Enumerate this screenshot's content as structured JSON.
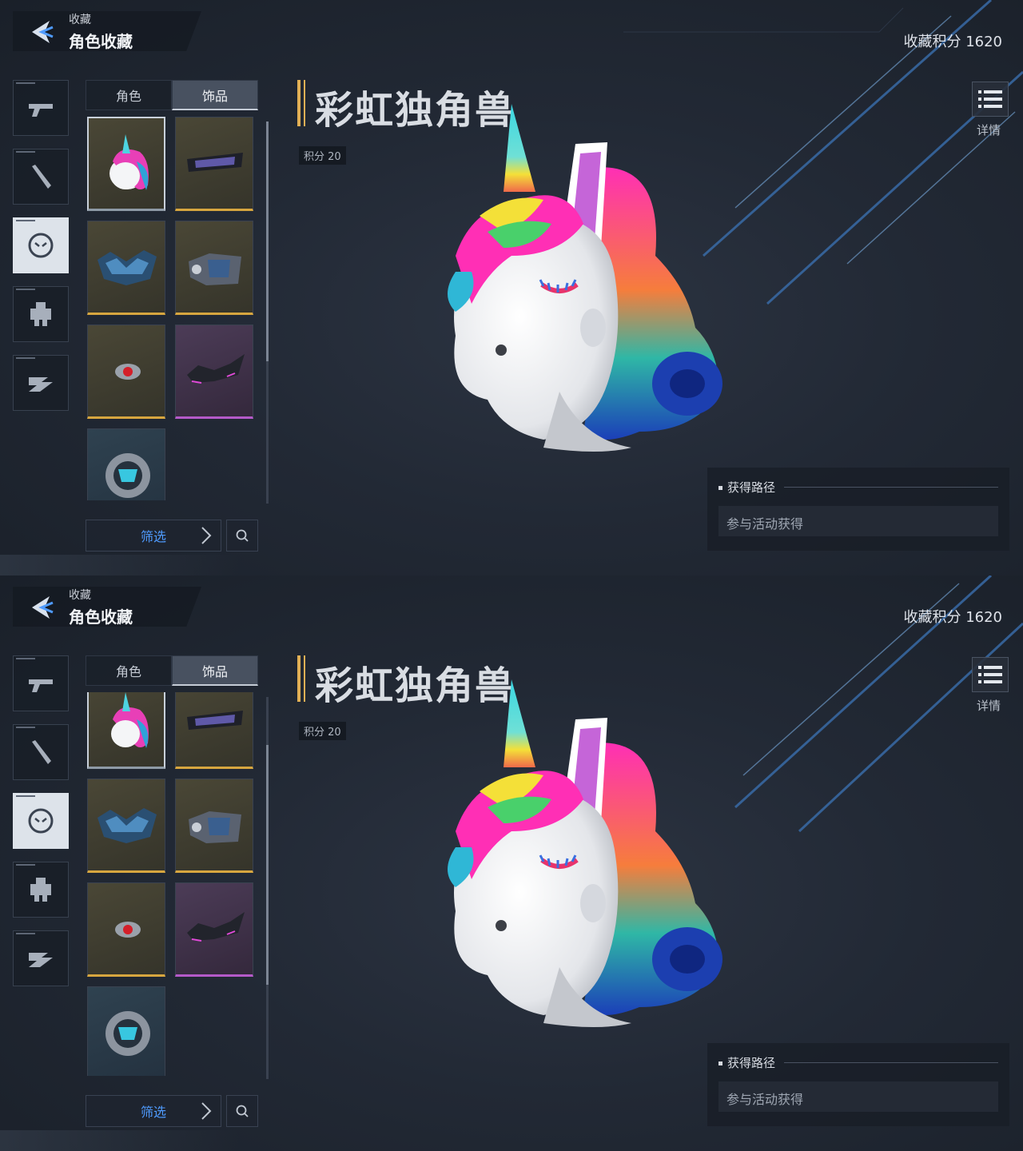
{
  "header": {
    "breadcrumb": "收藏",
    "title": "角色收藏",
    "score_total": "收藏积分 1620"
  },
  "rail": {
    "items": [
      {
        "name": "weapon-pistol",
        "active": false
      },
      {
        "name": "weapon-melee",
        "active": false
      },
      {
        "name": "character-mask",
        "active": true
      },
      {
        "name": "mech",
        "active": false
      },
      {
        "name": "vehicle",
        "active": false
      }
    ]
  },
  "tabs": [
    {
      "label": "角色",
      "active": false
    },
    {
      "label": "饰品",
      "active": true
    }
  ],
  "grid_items": [
    {
      "icon": "unicorn-head",
      "rarity": "gold",
      "selected": true
    },
    {
      "icon": "visor-glasses",
      "rarity": "gold"
    },
    {
      "icon": "crystal-mask",
      "rarity": "gold"
    },
    {
      "icon": "armor-mask",
      "rarity": "gold"
    },
    {
      "icon": "red-eye-lens",
      "rarity": "gold"
    },
    {
      "icon": "spike-mask",
      "rarity": "purple"
    },
    {
      "icon": "tech-ring",
      "rarity": "blue"
    }
  ],
  "filter": {
    "label": "筛选"
  },
  "item": {
    "title": "彩虹独角兽",
    "score": "积分 20",
    "detail_label": "详情"
  },
  "acquire": {
    "heading": "获得路径",
    "value": "参与活动获得"
  },
  "colors": {
    "accent": "#e2b055",
    "filter_text": "#4f9bff",
    "gold": "#d7a63f",
    "purple": "#b55ac9",
    "blue": "#4fa6d6"
  }
}
